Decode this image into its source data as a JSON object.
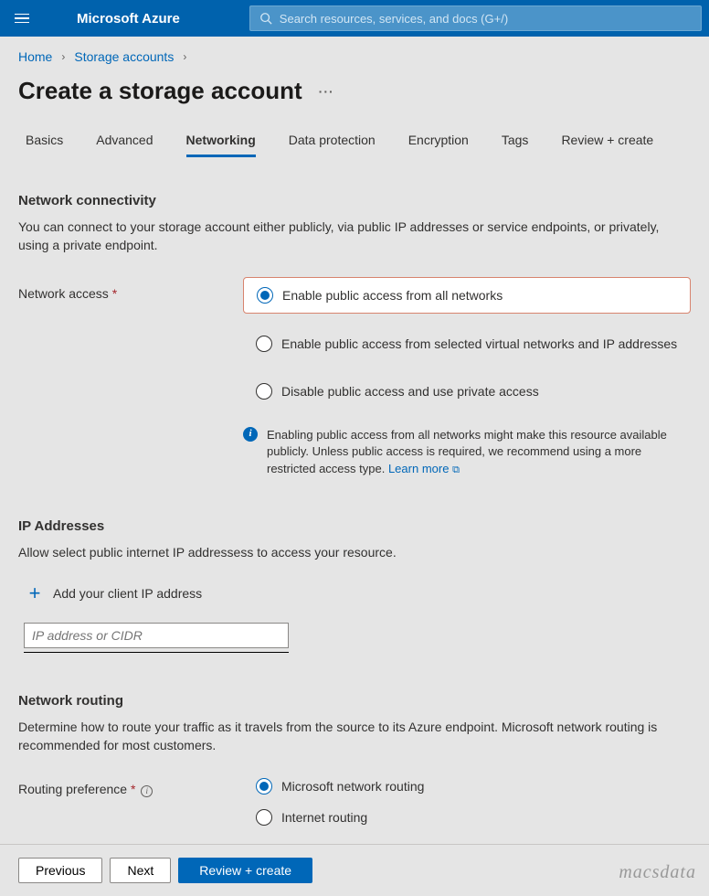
{
  "brand": "Microsoft Azure",
  "search": {
    "placeholder": "Search resources, services, and docs (G+/)"
  },
  "breadcrumb": {
    "home": "Home",
    "storage": "Storage accounts"
  },
  "page_title": "Create a storage account",
  "tabs": {
    "basics": "Basics",
    "advanced": "Advanced",
    "networking": "Networking",
    "data_protection": "Data protection",
    "encryption": "Encryption",
    "tags": "Tags",
    "review": "Review + create"
  },
  "network_connectivity": {
    "title": "Network connectivity",
    "desc": "You can connect to your storage account either publicly, via public IP addresses or service endpoints, or privately, using a private endpoint.",
    "field_label": "Network access ",
    "options": {
      "opt1": "Enable public access from all networks",
      "opt2": "Enable public access from selected virtual networks and IP addresses",
      "opt3": "Disable public access and use private access"
    },
    "info": "Enabling public access from all networks might make this resource available publicly. Unless public access is required, we recommend using a more restricted access type. ",
    "learn_more": "Learn more"
  },
  "ip": {
    "title": "IP Addresses",
    "desc": "Allow select public internet IP addressess to access your resource.",
    "add_label": "Add your client IP address",
    "placeholder": "IP address or CIDR"
  },
  "routing": {
    "title": "Network routing",
    "desc": "Determine how to route your traffic as it travels from the source to its Azure endpoint. Microsoft network routing is recommended for most customers.",
    "field_label": "Routing preference ",
    "opt1": "Microsoft network routing",
    "opt2": "Internet routing"
  },
  "footer": {
    "previous": "Previous",
    "next": "Next",
    "review": "Review + create"
  },
  "watermark": "macsdata"
}
